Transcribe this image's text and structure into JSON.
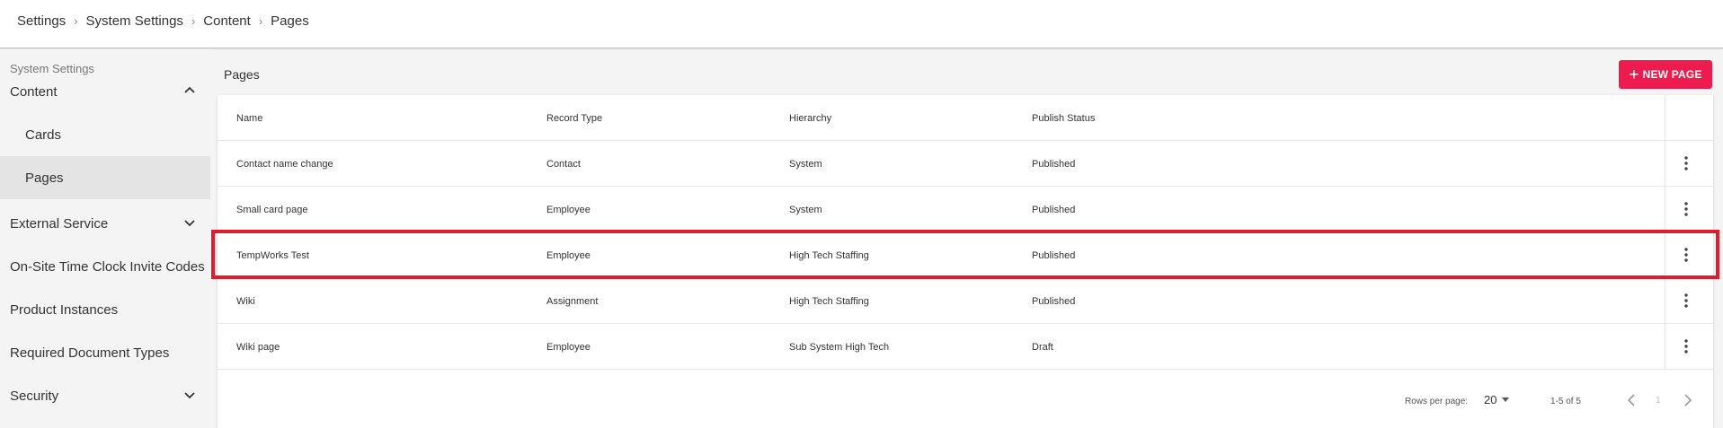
{
  "breadcrumb": [
    "Settings",
    "System Settings",
    "Content",
    "Pages"
  ],
  "sidebar": {
    "header": "System Settings",
    "items": [
      {
        "label": "Content",
        "chevron": "up"
      },
      {
        "label": "Cards"
      },
      {
        "label": "Pages"
      },
      {
        "label": "External Service",
        "chevron": "down"
      },
      {
        "label": "On-Site Time Clock Invite Codes"
      },
      {
        "label": "Product Instances"
      },
      {
        "label": "Required Document Types"
      },
      {
        "label": "Security",
        "chevron": "down"
      }
    ]
  },
  "main": {
    "title": "Pages",
    "new_button_label": "NEW PAGE"
  },
  "table": {
    "columns": [
      "Name",
      "Record Type",
      "Hierarchy",
      "Publish Status"
    ],
    "rows": [
      [
        "Contact name change",
        "Contact",
        "System",
        "Published"
      ],
      [
        "Small card page",
        "Employee",
        "System",
        "Published"
      ],
      [
        "TempWorks Test",
        "Employee",
        "High Tech Staffing",
        "Published"
      ],
      [
        "Wiki",
        "Assignment",
        "High Tech Staffing",
        "Published"
      ],
      [
        "Wiki page",
        "Employee",
        "Sub System High Tech",
        "Draft"
      ]
    ]
  },
  "pagination": {
    "rows_per_page_label": "Rows per page:",
    "rows_per_page": "20",
    "range": "1-5 of 5",
    "page": "1"
  },
  "colors": {
    "accent": "#ee1c4e",
    "highlight": "#e11d2d"
  },
  "icons": {
    "breadcrumb_separator": "chevron-right-icon",
    "row_menu": "kebab-menu-icon",
    "new_page": "plus-icon",
    "prev_page": "chevron-left-icon",
    "next_page": "chevron-right-icon",
    "rows_per_page_dropdown": "caret-down-icon"
  }
}
